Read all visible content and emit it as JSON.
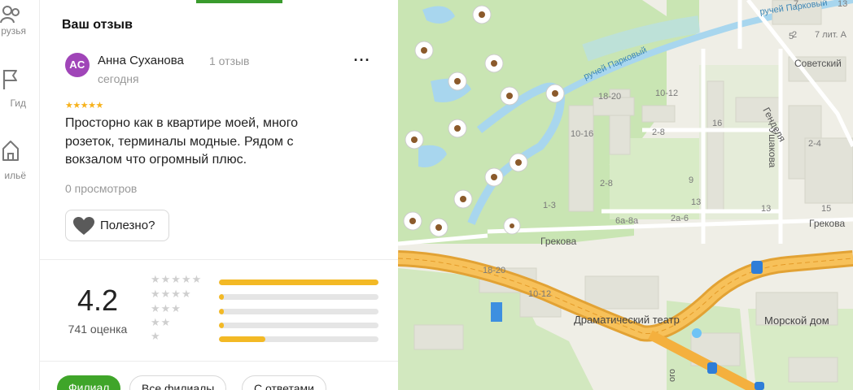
{
  "nav": {
    "items": [
      {
        "label": "рузья",
        "icon": "friends-icon"
      },
      {
        "label": "Гид",
        "icon": "flag-icon"
      },
      {
        "label": "ильё",
        "icon": "housing-icon"
      }
    ]
  },
  "panel": {
    "title": "Ваш отзыв",
    "review": {
      "avatar_initials": "АС",
      "avatar_color": "#a045b8",
      "author": "Анна Суханова",
      "author_review_count": "1 отзыв",
      "date": "сегодня",
      "rating": 5,
      "stars": "★★★★★",
      "text": "Просторно как в квартире моей, много розеток, терминалы модные. Рядом с вокзалом что огромный плюс.",
      "views": "0 просмотров",
      "helpful_label": "Полезно?"
    },
    "summary": {
      "rating": "4.2",
      "count": "741 оценка",
      "distribution": [
        {
          "stars": "★★★★★",
          "fraction": 1.0
        },
        {
          "stars": "★★★★",
          "fraction": 0.03
        },
        {
          "stars": "★★★",
          "fraction": 0.03
        },
        {
          "stars": "★★",
          "fraction": 0.03
        },
        {
          "stars": "★",
          "fraction": 0.29
        }
      ]
    },
    "filters": [
      "Филиал",
      "Все филиалы",
      "С ответами"
    ]
  },
  "map": {
    "streets": {
      "grekova1": "Грекова",
      "grekova2": "Грекова",
      "sovetsky": "Советский",
      "gendelya": "Генделя",
      "ushakova": "Ушакова",
      "creek1": "ручей Парковый",
      "creek2": "ручей Парковый",
      "creek_road": "ого"
    },
    "pois": {
      "theatre": "Драматический театр",
      "marine_house": "Морской дом"
    },
    "buildings": [
      "7 лит. А",
      "18-20",
      "10-12",
      "10-16",
      "2-8",
      "16",
      "9",
      "2-4",
      "1-3",
      "6а-8а",
      "2а-6",
      "2-8",
      "18-20",
      "10-12",
      "5",
      "2",
      "7",
      "13",
      "13",
      "15",
      "13"
    ],
    "colors": {
      "park": "#c9e5b3",
      "water": "#a8d6ee",
      "highway": "#f4b03e",
      "green_accent": "#3a9b2d"
    }
  }
}
